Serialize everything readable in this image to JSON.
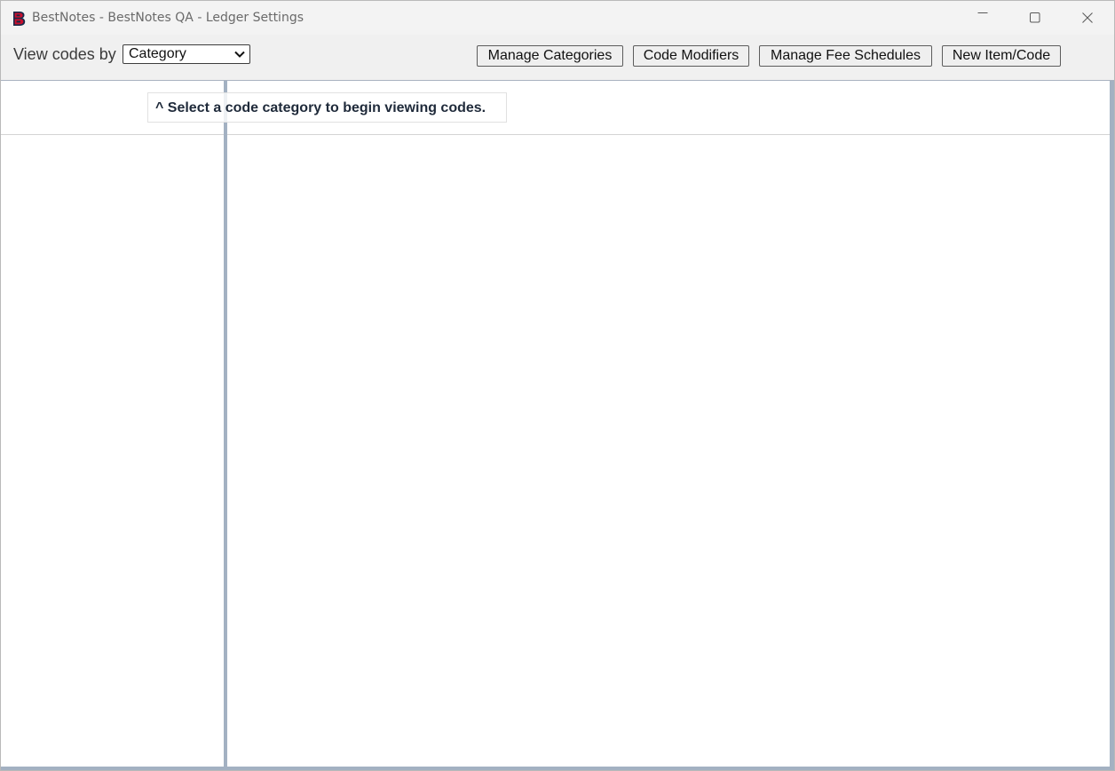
{
  "window": {
    "title": "BestNotes - BestNotes QA - Ledger Settings",
    "logo_letter": "B",
    "controls": {
      "minimize": "minimize-icon",
      "maximize": "maximize-icon",
      "close": "close-icon"
    }
  },
  "toolbar": {
    "view_label": "View codes by",
    "view_select": {
      "selected": "Category"
    },
    "buttons": {
      "manage_categories": "Manage Categories",
      "code_modifiers": "Code Modifiers",
      "manage_fee_schedules": "Manage Fee Schedules",
      "new_item_code": "New Item/Code"
    }
  },
  "main": {
    "hint": "^ Select a code category to begin viewing codes."
  },
  "colors": {
    "titlebar_bg": "#f3f3f3",
    "toolbar_bg": "#f0f0f0",
    "splitter": "#a3b1c2",
    "logo_red": "#c8102e",
    "logo_navy": "#1b2a4a",
    "hint_text": "#1f2a3a"
  }
}
